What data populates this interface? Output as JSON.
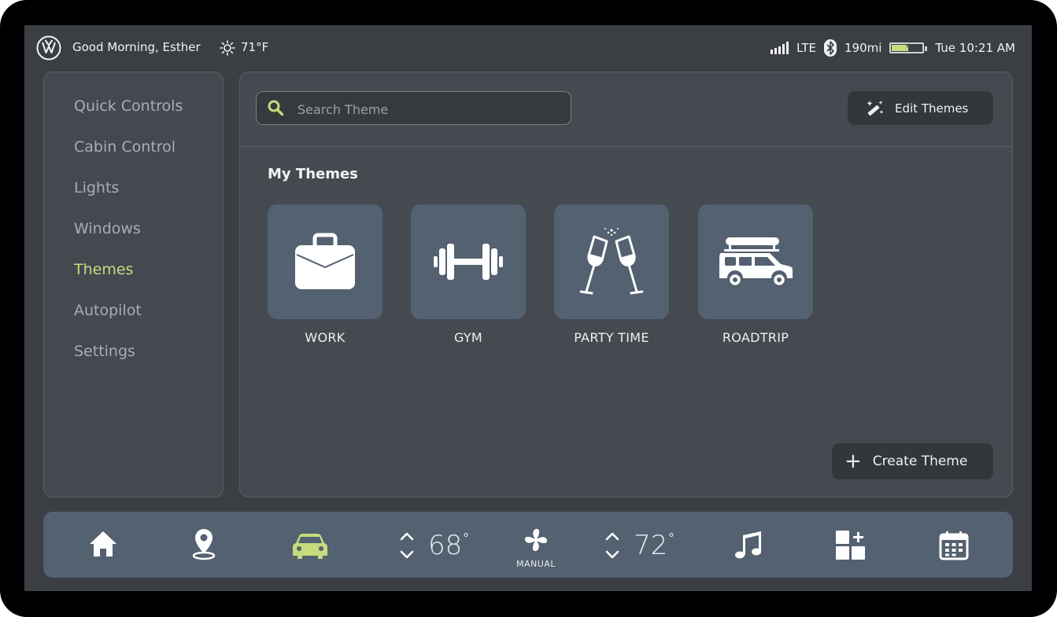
{
  "status": {
    "greeting": "Good Morning, Esther",
    "outside_temp": "71°F",
    "network": "LTE",
    "range": "190mi",
    "battery_level": 0.55,
    "datetime": "Tue 10:21 AM"
  },
  "sidebar": {
    "items": [
      {
        "label": "Quick Controls",
        "active": false
      },
      {
        "label": "Cabin Control",
        "active": false
      },
      {
        "label": "Lights",
        "active": false
      },
      {
        "label": "Windows",
        "active": false
      },
      {
        "label": "Themes",
        "active": true
      },
      {
        "label": "Autopilot",
        "active": false
      },
      {
        "label": "Settings",
        "active": false
      }
    ]
  },
  "main": {
    "search_placeholder": "Search Theme",
    "edit_label": "Edit Themes",
    "section_title": "My Themes",
    "themes": [
      {
        "label": "WORK",
        "icon": "briefcase-icon"
      },
      {
        "label": "GYM",
        "icon": "dumbbell-icon"
      },
      {
        "label": "PARTY TIME",
        "icon": "champagne-icon"
      },
      {
        "label": "ROADTRIP",
        "icon": "car-roofbox-icon"
      }
    ],
    "create_label": "Create Theme"
  },
  "dock": {
    "driver_temp": "68",
    "passenger_temp": "72",
    "degree_symbol": "°",
    "fan_mode": "MANUAL"
  },
  "colors": {
    "accent": "#c5db7d",
    "background": "#3b3e43",
    "panel": "#454a51",
    "tile": "#546170"
  }
}
